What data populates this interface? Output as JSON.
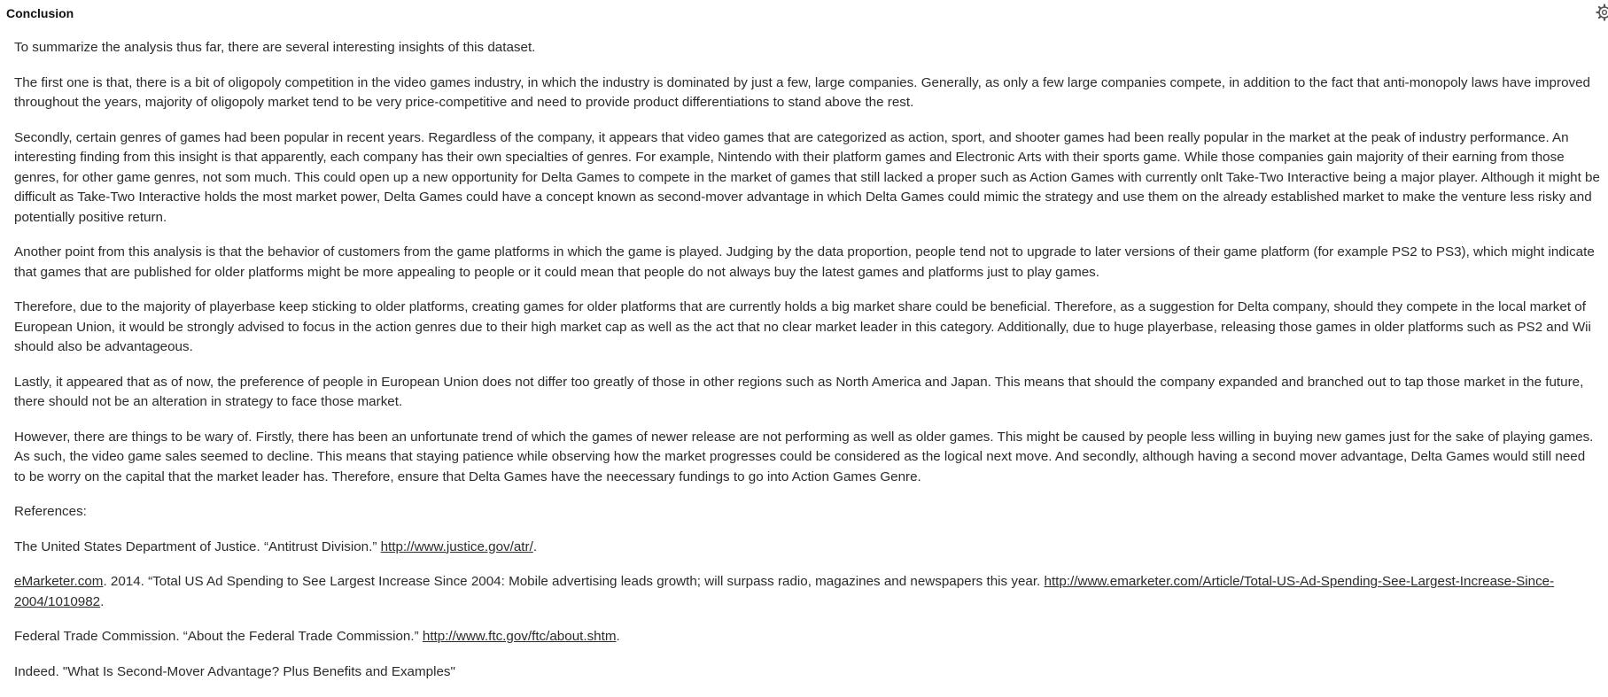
{
  "header": {
    "title": "Conclusion",
    "settings_icon": "gear-icon"
  },
  "body": {
    "intro": "To summarize the analysis thus far, there are several interesting insights of this dataset.",
    "paragraphs": [
      "The first one is that, there is a bit of oligopoly competition in the video games industry, in which the industry is dominated by just a few, large companies. Generally, as only a few large companies compete, in addition to the fact that anti-monopoly laws have improved throughout the years, majority of oligopoly market tend to be very price-competitive and need to provide product differentiations to stand above the rest.",
      "Secondly, certain genres of games had been popular in recent years. Regardless of the company, it appears that video games that are categorized as action, sport, and shooter games had been really popular in the market at the peak of industry performance. An interesting finding from this insight is that apparently, each company has their own specialties of genres. For example, Nintendo with their platform games and Electronic Arts with their sports game. While those companies gain majority of their earning from those genres, for other game genres, not som much. This could open up a new opportunity for Delta Games to compete in the market of games that still lacked a proper such as Action Games with currently onlt Take-Two Interactive being a major player. Although it might be difficult as Take-Two Interactive holds the most market power, Delta Games could have a concept known as second-mover advantage in which Delta Games could mimic the strategy and use them on the already established market to make the venture less risky and potentially positive return.",
      "Another point from this analysis is that the behavior of customers from the game platforms in which the game is played. Judging by the data proportion, people tend not to upgrade to later versions of their game platform (for example PS2 to PS3), which might indicate that games that are published for older platforms might be more appealing to people or it could mean that people do not always buy the latest games and platforms just to play games.",
      "Therefore, due to the majority of playerbase keep sticking to older platforms, creating games for older platforms that are currently holds a big market share could be beneficial. Therefore, as a suggestion for Delta company, should they compete in the local market of European Union, it would be strongly advised to focus in the action genres due to their high market cap as well as the act that no clear market leader in this category. Additionally, due to huge playerbase, releasing those games in older platforms such as PS2 and Wii should also be advantageous.",
      "Lastly, it appeared that as of now, the preference of people in European Union does not differ too greatly of those in other regions such as North America and Japan. This means that should the company expanded and branched out to tap those market in the future, there should not be an alteration in strategy to face those market.",
      "However, there are things to be wary of. Firstly, there has been an unfortunate trend of which the games of newer release are not performing as well as older games. This might be caused by people less willing in buying new games just for the sake of playing games. As such, the video game sales seemed to decline. This means that staying patience while observing how the market progresses could be considered as the logical next move. And secondly, although having a second mover advantage, Delta Games would still need to be worry on the capital that the market leader has. Therefore, ensure that Delta Games have the neecessary fundings to go into Action Games Genre."
    ],
    "references_heading": "References:",
    "references": [
      {
        "before": "The United States Department of Justice. “Antitrust Division.” ",
        "link": "http://www.justice.gov/atr/",
        "after": "."
      },
      {
        "link_lead": "eMarketer.com",
        "before": ". 2014. “Total US Ad Spending to See Largest Increase Since 2004: Mobile advertising leads growth; will surpass radio, magazines and newspapers this year. ",
        "link": "http://www.emarketer.com/Article/Total-US-Ad-Spending-See-Largest-Increase-Since-2004/1010982",
        "after": "."
      },
      {
        "before": "Federal Trade Commission. “About the Federal Trade Commission.” ",
        "link": "http://www.ftc.gov/ftc/about.shtm",
        "after": "."
      },
      {
        "text": "Indeed. \"What Is Second-Mover Advantage? Plus Benefits and Examples\""
      }
    ]
  }
}
